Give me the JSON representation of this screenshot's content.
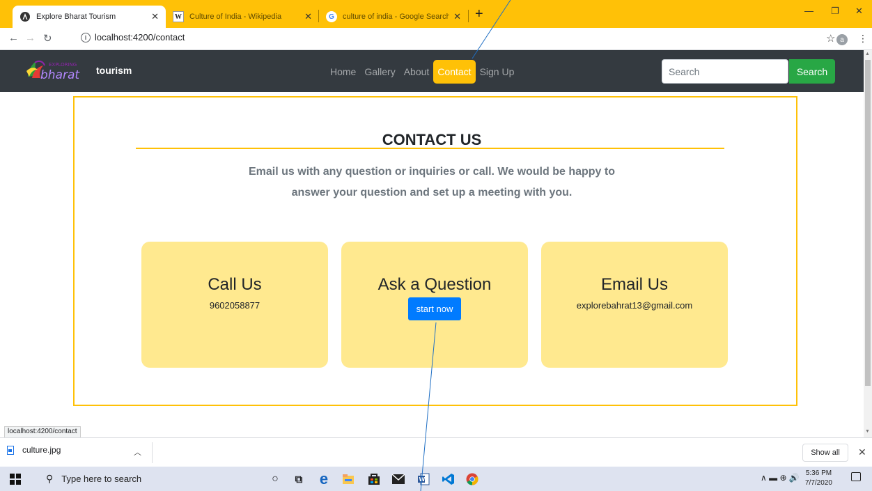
{
  "browser": {
    "tabs": [
      {
        "title": "Explore Bharat Tourism",
        "favicon": "angular-icon",
        "active": true
      },
      {
        "title": "Culture of India - Wikipedia",
        "favicon": "wikipedia-icon",
        "active": false
      },
      {
        "title": "culture of india - Google Search",
        "favicon": "google-icon",
        "active": false
      }
    ],
    "url": "localhost:4200/contact",
    "profile_initial": "a",
    "accent": "#ffc107"
  },
  "site": {
    "logo_text": "EXPLORING",
    "logo_script": "bharat",
    "brand": "tourism",
    "nav": [
      "Home",
      "Gallery",
      "About",
      "Contact",
      "Sign Up"
    ],
    "active_nav": "Contact",
    "search_placeholder": "Search",
    "search_button": "Search"
  },
  "contact": {
    "heading": "CONTACT US",
    "lead_line1": "Email us with any question or inquiries or call. We would be happy to",
    "lead_line2": "answer your question and set up a meeting with you.",
    "cards": [
      {
        "title": "Call Us",
        "value": "9602058877"
      },
      {
        "title": "Ask a Question",
        "button": "start now"
      },
      {
        "title": "Email Us",
        "value": "explorebahrat13@gmail.com"
      }
    ]
  },
  "status_url": "localhost:4200/contact",
  "download": {
    "file": "culture.jpg",
    "show_all": "Show all"
  },
  "taskbar": {
    "search_placeholder": "Type here to search",
    "time": "5:36 PM",
    "date": "7/7/2020"
  }
}
